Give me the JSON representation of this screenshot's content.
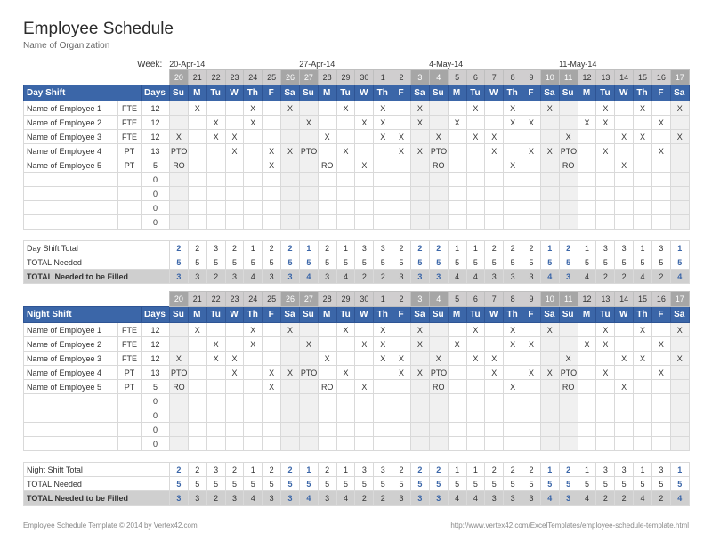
{
  "title": "Employee Schedule",
  "subtitle": "Name of Organization",
  "week_label": "Week:",
  "week_starts": [
    "20-Apr-14",
    "27-Apr-14",
    "4-May-14",
    "11-May-14"
  ],
  "date_nums": [
    20,
    21,
    22,
    23,
    24,
    25,
    26,
    27,
    28,
    29,
    30,
    1,
    2,
    3,
    4,
    5,
    6,
    7,
    8,
    9,
    10,
    11,
    12,
    13,
    14,
    15,
    16,
    17
  ],
  "dows": [
    "Su",
    "M",
    "Tu",
    "W",
    "Th",
    "F",
    "Sa",
    "Su",
    "M",
    "Tu",
    "W",
    "Th",
    "F",
    "Sa",
    "Su",
    "M",
    "Tu",
    "W",
    "Th",
    "F",
    "Sa",
    "Su",
    "M",
    "Tu",
    "W",
    "Th",
    "F",
    "Sa"
  ],
  "weekend_idx": {
    "0": 1,
    "6": 1,
    "7": 1,
    "13": 1,
    "14": 1,
    "20": 1,
    "21": 1,
    "27": 1
  },
  "days_label": "Days",
  "day_shift": {
    "title": "Day Shift",
    "employees": [
      {
        "name": "Name of Employee 1",
        "type": "FTE",
        "days": "12",
        "marks": [
          "",
          "X",
          "",
          "",
          "X",
          "",
          "X",
          "",
          "",
          "X",
          "",
          "X",
          "",
          "X",
          "",
          "",
          "X",
          "",
          "X",
          "",
          "X",
          "",
          "",
          "X",
          "",
          "X",
          "",
          "X"
        ]
      },
      {
        "name": "Name of Employee 2",
        "type": "FTE",
        "days": "12",
        "marks": [
          "",
          "",
          "X",
          "",
          "X",
          "",
          "",
          "X",
          "",
          "",
          "X",
          "X",
          "",
          "X",
          "",
          "X",
          "",
          "",
          "X",
          "X",
          "",
          "",
          "X",
          "X",
          "",
          "",
          "X",
          ""
        ]
      },
      {
        "name": "Name of Employee 3",
        "type": "FTE",
        "days": "12",
        "marks": [
          "X",
          "",
          "X",
          "X",
          "",
          "",
          "",
          "",
          "X",
          "",
          "",
          "X",
          "X",
          "",
          "X",
          "",
          "X",
          "X",
          "",
          "",
          "",
          "X",
          "",
          "",
          "X",
          "X",
          "",
          "X"
        ]
      },
      {
        "name": "Name of Employee 4",
        "type": "PT",
        "days": "13",
        "marks": [
          "PTO",
          "",
          "",
          "X",
          "",
          "X",
          "X",
          "PTO",
          "",
          "X",
          "",
          "",
          "X",
          "X",
          "PTO",
          "",
          "",
          "X",
          "",
          "X",
          "X",
          "PTO",
          "",
          "X",
          "",
          "",
          "X",
          ""
        ]
      },
      {
        "name": "Name of Employee 5",
        "type": "PT",
        "days": "5",
        "marks": [
          "RO",
          "",
          "",
          "",
          "",
          "X",
          "",
          "",
          "RO",
          "",
          "X",
          "",
          "",
          "",
          "RO",
          "",
          "",
          "",
          "X",
          "",
          "",
          "RO",
          "",
          "",
          "X",
          "",
          "",
          ""
        ]
      },
      {
        "name": "",
        "type": "",
        "days": "0",
        "marks": []
      },
      {
        "name": "",
        "type": "",
        "days": "0",
        "marks": []
      },
      {
        "name": "",
        "type": "",
        "days": "0",
        "marks": []
      },
      {
        "name": "",
        "type": "",
        "days": "0",
        "marks": []
      }
    ],
    "totals": [
      {
        "label": "Day Shift Total",
        "vals": [
          2,
          2,
          3,
          2,
          1,
          2,
          2,
          1,
          2,
          1,
          3,
          3,
          2,
          2,
          2,
          1,
          1,
          2,
          2,
          2,
          1,
          2,
          1,
          3,
          3,
          1,
          3,
          1
        ]
      },
      {
        "label": "TOTAL Needed",
        "vals": [
          5,
          5,
          5,
          5,
          5,
          5,
          5,
          5,
          5,
          5,
          5,
          5,
          5,
          5,
          5,
          5,
          5,
          5,
          5,
          5,
          5,
          5,
          5,
          5,
          5,
          5,
          5,
          5
        ]
      },
      {
        "label": "TOTAL Needed to be Filled",
        "vals": [
          3,
          3,
          2,
          3,
          4,
          3,
          3,
          4,
          3,
          4,
          2,
          2,
          3,
          3,
          3,
          4,
          4,
          3,
          3,
          3,
          4,
          3,
          4,
          2,
          2,
          4,
          2,
          4
        ]
      }
    ]
  },
  "night_shift": {
    "title": "Night Shift",
    "employees": [
      {
        "name": "Name of Employee 1",
        "type": "FTE",
        "days": "12",
        "marks": [
          "",
          "X",
          "",
          "",
          "X",
          "",
          "X",
          "",
          "",
          "X",
          "",
          "X",
          "",
          "X",
          "",
          "",
          "X",
          "",
          "X",
          "",
          "X",
          "",
          "",
          "X",
          "",
          "X",
          "",
          "X"
        ]
      },
      {
        "name": "Name of Employee 2",
        "type": "FTE",
        "days": "12",
        "marks": [
          "",
          "",
          "X",
          "",
          "X",
          "",
          "",
          "X",
          "",
          "",
          "X",
          "X",
          "",
          "X",
          "",
          "X",
          "",
          "",
          "X",
          "X",
          "",
          "",
          "X",
          "X",
          "",
          "",
          "X",
          ""
        ]
      },
      {
        "name": "Name of Employee 3",
        "type": "FTE",
        "days": "12",
        "marks": [
          "X",
          "",
          "X",
          "X",
          "",
          "",
          "",
          "",
          "X",
          "",
          "",
          "X",
          "X",
          "",
          "X",
          "",
          "X",
          "X",
          "",
          "",
          "",
          "X",
          "",
          "",
          "X",
          "X",
          "",
          "X"
        ]
      },
      {
        "name": "Name of Employee 4",
        "type": "PT",
        "days": "13",
        "marks": [
          "PTO",
          "",
          "",
          "X",
          "",
          "X",
          "X",
          "PTO",
          "",
          "X",
          "",
          "",
          "X",
          "X",
          "PTO",
          "",
          "",
          "X",
          "",
          "X",
          "X",
          "PTO",
          "",
          "X",
          "",
          "",
          "X",
          ""
        ]
      },
      {
        "name": "Name of Employee 5",
        "type": "PT",
        "days": "5",
        "marks": [
          "RO",
          "",
          "",
          "",
          "",
          "X",
          "",
          "",
          "RO",
          "",
          "X",
          "",
          "",
          "",
          "RO",
          "",
          "",
          "",
          "X",
          "",
          "",
          "RO",
          "",
          "",
          "X",
          "",
          "",
          ""
        ]
      },
      {
        "name": "",
        "type": "",
        "days": "0",
        "marks": []
      },
      {
        "name": "",
        "type": "",
        "days": "0",
        "marks": []
      },
      {
        "name": "",
        "type": "",
        "days": "0",
        "marks": []
      },
      {
        "name": "",
        "type": "",
        "days": "0",
        "marks": []
      }
    ],
    "totals": [
      {
        "label": "Night Shift Total",
        "vals": [
          2,
          2,
          3,
          2,
          1,
          2,
          2,
          1,
          2,
          1,
          3,
          3,
          2,
          2,
          2,
          1,
          1,
          2,
          2,
          2,
          1,
          2,
          1,
          3,
          3,
          1,
          3,
          1
        ]
      },
      {
        "label": "TOTAL Needed",
        "vals": [
          5,
          5,
          5,
          5,
          5,
          5,
          5,
          5,
          5,
          5,
          5,
          5,
          5,
          5,
          5,
          5,
          5,
          5,
          5,
          5,
          5,
          5,
          5,
          5,
          5,
          5,
          5,
          5
        ]
      },
      {
        "label": "TOTAL Needed to be Filled",
        "vals": [
          3,
          3,
          2,
          3,
          4,
          3,
          3,
          4,
          3,
          4,
          2,
          2,
          3,
          3,
          3,
          4,
          4,
          3,
          3,
          3,
          4,
          3,
          4,
          2,
          2,
          4,
          2,
          4
        ]
      }
    ]
  },
  "footer_left": "Employee Schedule Template © 2014 by Vertex42.com",
  "footer_right": "http://www.vertex42.com/ExcelTemplates/employee-schedule-template.html"
}
